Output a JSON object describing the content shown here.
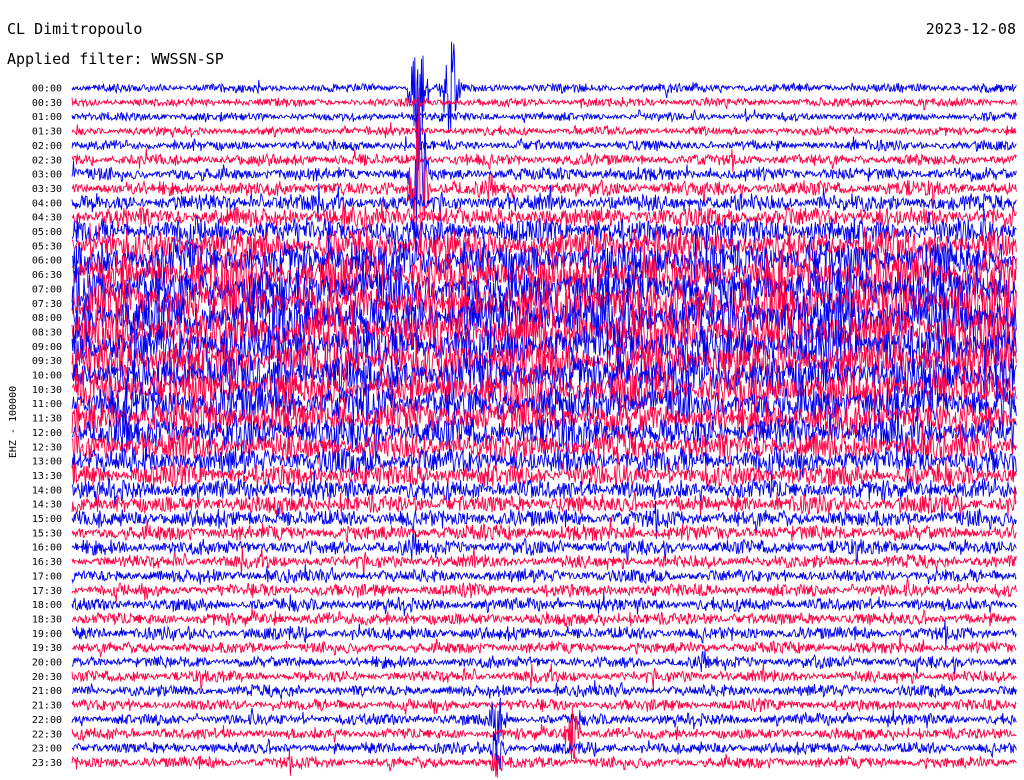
{
  "header": {
    "station": "CL Dimitropoulo",
    "filter": "Applied filter: WWSSN-SP",
    "date": "2023-12-08"
  },
  "chart_data": {
    "type": "line",
    "title": "CL Dimitropoulo",
    "subtitle": "Applied filter: WWSSN-SP",
    "date": "2023-12-08",
    "ylabel": "EHZ - 100000",
    "row_colors": [
      "#0000ee",
      "#ff0044"
    ],
    "row_labels": [
      "00:00",
      "00:30",
      "01:00",
      "01:30",
      "02:00",
      "02:30",
      "03:00",
      "03:30",
      "04:00",
      "04:30",
      "05:00",
      "05:30",
      "06:00",
      "06:30",
      "07:00",
      "07:30",
      "08:00",
      "08:30",
      "09:00",
      "09:30",
      "10:00",
      "10:30",
      "11:00",
      "11:30",
      "12:00",
      "12:30",
      "13:00",
      "13:30",
      "14:00",
      "14:30",
      "15:00",
      "15:30",
      "16:00",
      "16:30",
      "17:00",
      "17:30",
      "18:00",
      "18:30",
      "19:00",
      "19:30",
      "20:00",
      "20:30",
      "21:00",
      "21:30",
      "22:00",
      "22:30",
      "23:00",
      "23:30"
    ],
    "noise_level": [
      3,
      3,
      3,
      3,
      3.5,
      4,
      4.5,
      5,
      6,
      7,
      9,
      11,
      13,
      14,
      15,
      16,
      16,
      15,
      15,
      14,
      14,
      13,
      13,
      12,
      11,
      10,
      9,
      8,
      7,
      6.5,
      6,
      5.5,
      5,
      4.5,
      4.5,
      4.5,
      4.5,
      4.5,
      4.5,
      4,
      4,
      4,
      4,
      4,
      4,
      4,
      4,
      4
    ],
    "events": [
      {
        "row": 0,
        "minute": 11.0,
        "amp": 95
      },
      {
        "row": 0,
        "minute": 12.0,
        "amp": 85
      },
      {
        "row": 6,
        "minute": 11.0,
        "amp": 140
      },
      {
        "row": 7,
        "minute": 11.0,
        "amp": 110
      },
      {
        "row": 44,
        "minute": 13.5,
        "amp": 50
      },
      {
        "row": 45,
        "minute": 15.9,
        "amp": 40
      },
      {
        "row": 46,
        "minute": 13.5,
        "amp": 35
      },
      {
        "row": 47,
        "minute": 13.5,
        "amp": 25
      }
    ]
  }
}
